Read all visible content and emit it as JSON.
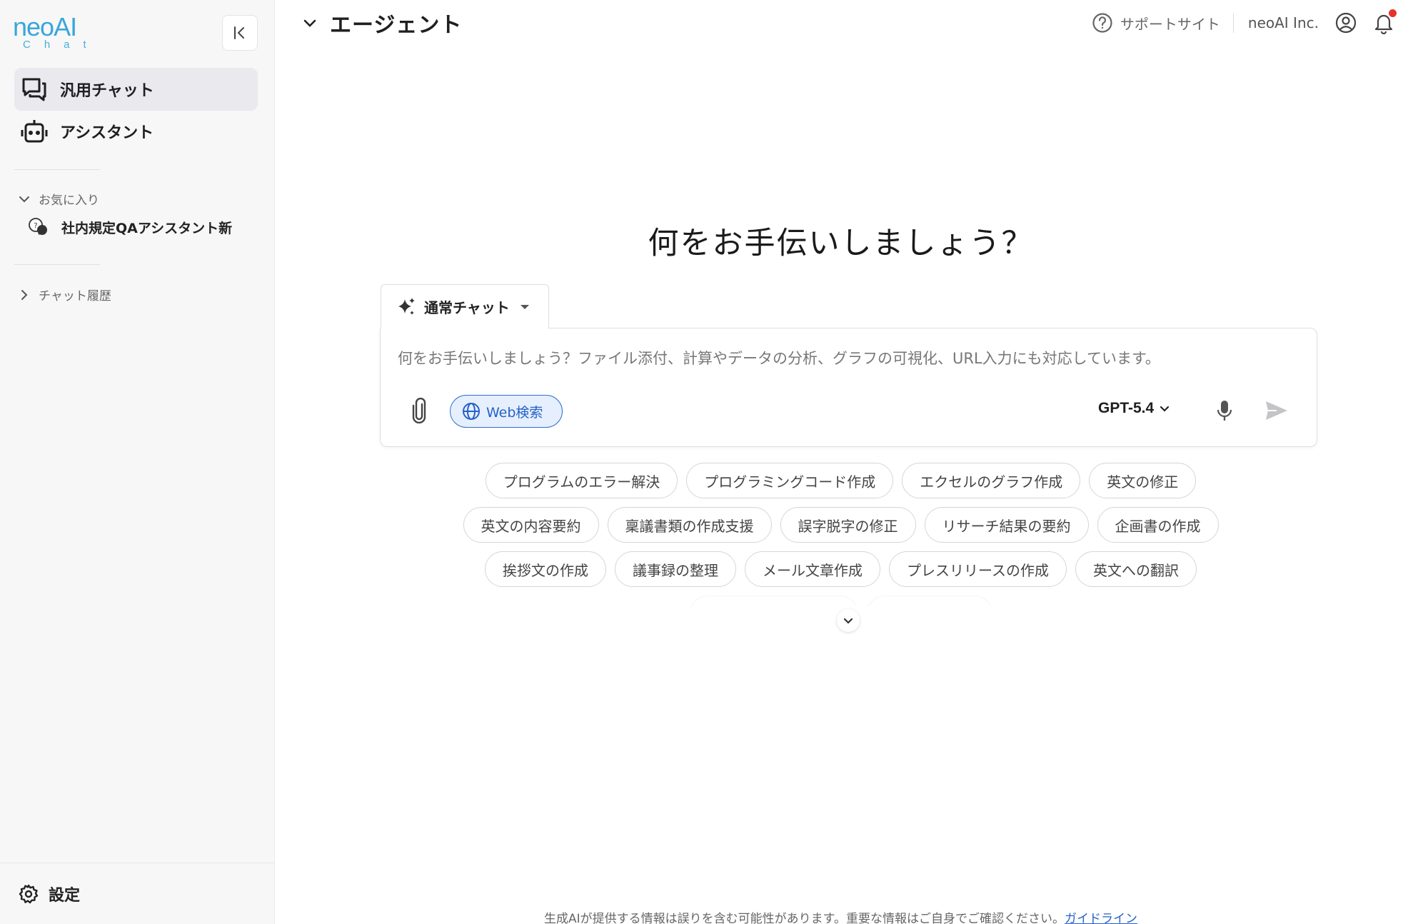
{
  "sidebar": {
    "logo": {
      "main": "neoAI",
      "sub": "Chat"
    },
    "nav": [
      {
        "label": "汎用チャット",
        "icon": "chat-bubbles-icon",
        "active": true
      },
      {
        "label": "アシスタント",
        "icon": "robot-icon",
        "active": false
      }
    ],
    "favorites": {
      "title": "お気に入り",
      "items": [
        {
          "label": "社内規定QAアシスタント新",
          "icon": "assistant-avatar-icon"
        }
      ]
    },
    "history": {
      "title": "チャット履歴"
    },
    "settings_label": "設定"
  },
  "header": {
    "title": "エージェント",
    "support_label": "サポートサイト",
    "org_name": "neoAI Inc.",
    "has_notification": true
  },
  "main": {
    "headline": "何をお手伝いしましょう？",
    "mode_label": "通常チャット",
    "input_placeholder": "何をお手伝いしましょう？ファイル添付、計算やデータの分析、グラフの可視化、URL入力にも対応しています。",
    "input_value": "",
    "web_search_label": "Web検索",
    "model_label": "GPT-5.4",
    "suggestions": [
      [
        "プログラムのエラー解決",
        "プログラミングコード作成",
        "エクセルのグラフ作成",
        "英文の修正"
      ],
      [
        "英文の内容要約",
        "稟議書類の作成支援",
        "誤字脱字の修正",
        "リサーチ結果の要約",
        "企画書の作成"
      ],
      [
        "挨拶文の作成",
        "議事録の整理",
        "メール文章作成",
        "プレスリリースの作成",
        "英文への翻訳"
      ]
    ],
    "footer_text": "生成AIが提供する情報は誤りを含む可能性があります。重要な情報はご自身でご確認ください。",
    "footer_link": "ガイドライン"
  },
  "colors": {
    "accent": "#2562c8",
    "logo": "#3aa6d9",
    "notification_dot": "#e5322d",
    "sidebar_bg": "#f7f7f8"
  }
}
